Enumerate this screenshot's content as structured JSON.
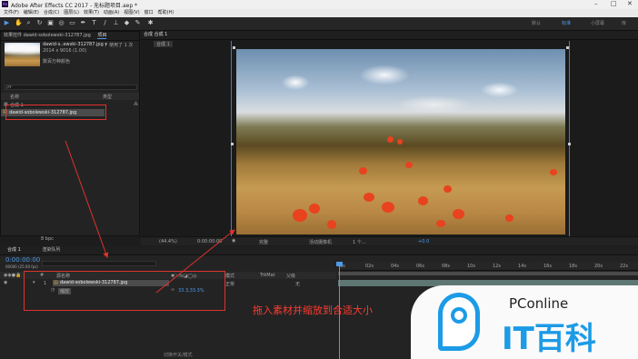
{
  "titlebar": {
    "title": "Adobe After Effects CC 2017 - 无标题项目.aep *",
    "min": "–",
    "max": "□",
    "close": "✕"
  },
  "menu": [
    "文件(F)",
    "编辑(E)",
    "合成(C)",
    "图层(L)",
    "效果(T)",
    "动画(A)",
    "视图(V)",
    "窗口",
    "帮助(H)"
  ],
  "workspaces": {
    "w1": "默认",
    "w2": "标准",
    "w3": "小屏幕",
    "w4": "库"
  },
  "left_panel": {
    "tab_effects": "效果控件 dawid-sobolewski-312787.jpg",
    "tab_project": "项目",
    "file_name": "dawid-s..ewski-312787.jpg ▾",
    "used": "，使用了 1 次",
    "file_dims": "2014 x 9016 (1.00)",
    "file_color": "数百万种颜色",
    "search_placeholder": "ρ▾",
    "col_name": "名称",
    "col_type": "类型",
    "items": [
      {
        "name": "合成 1",
        "type": ""
      },
      {
        "name": "dawid-sobolewski-312787.jpg",
        "type": ""
      }
    ],
    "bpc": "8 bpc"
  },
  "viewer": {
    "tab": "合成 合成 1",
    "sub": "合成 1",
    "zoom": "(44.4%)",
    "time": "0:00:00:00",
    "quality": "完整",
    "camera": "活动摄像机",
    "views": "1 个...",
    "exposure": "+0.0"
  },
  "timeline": {
    "tab1": "合成 1",
    "tab2": "渲染队列",
    "timecode": "0:00:00:00",
    "fps": "00000 (25.00 fps)",
    "col_num": "#",
    "col_source": "源名称",
    "col_mode": "模式",
    "col_trkmat": "TrkMat",
    "col_parent": "父级",
    "layer_num": "1",
    "layer_name": "dawid-sobolewski-312787.jpg",
    "layer_mode": "正常",
    "layer_parent": "无",
    "transform": "缩放",
    "scale": "33.3,33.3%",
    "ruler": [
      "0s",
      "02s",
      "04s",
      "06s",
      "08s",
      "10s",
      "12s",
      "14s",
      "16s",
      "18s",
      "20s",
      "22s"
    ],
    "footer": "切换开关/模式"
  },
  "annotation": "拖入素材并缩放到合适大小",
  "watermark": {
    "top": "PConline",
    "bottom": "IT百科"
  },
  "colors": {
    "accent": "#4e9be9",
    "annotation_red": "#e0322e",
    "panel": "#232323"
  }
}
